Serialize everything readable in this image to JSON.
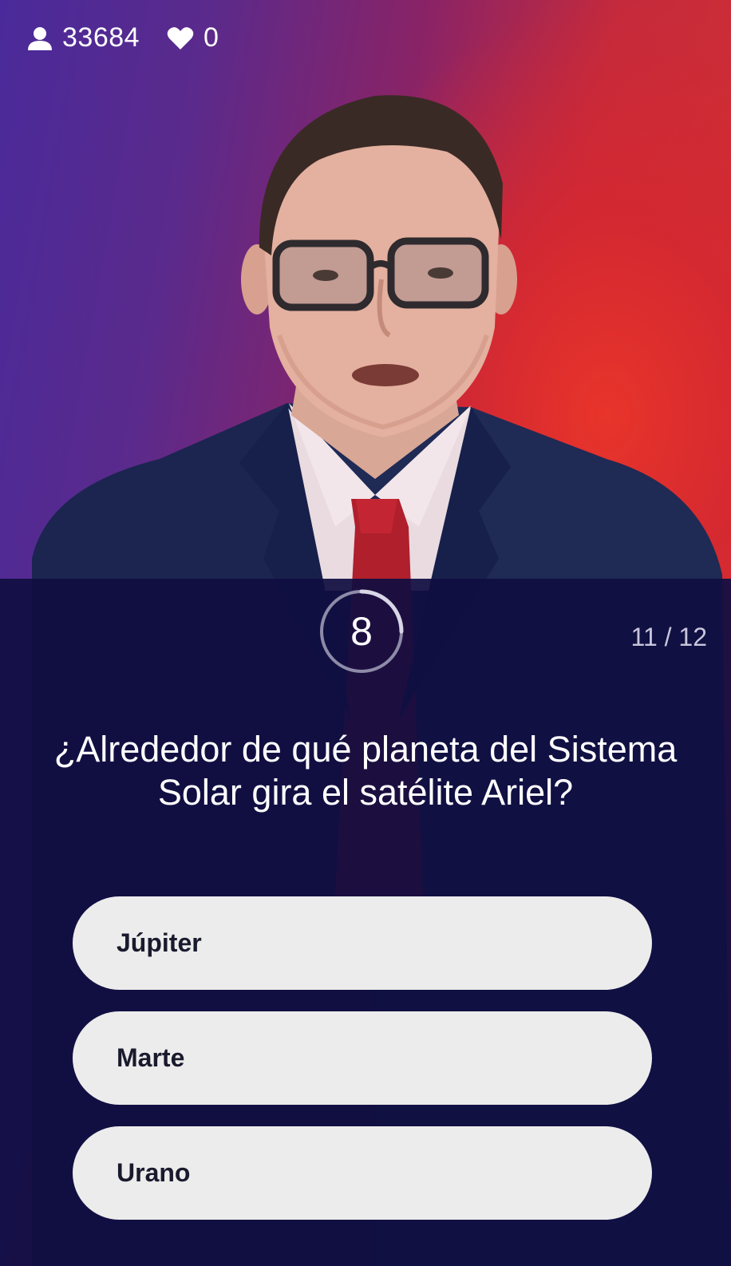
{
  "header": {
    "viewers_icon": "user-icon",
    "viewers_count": "33684",
    "lives_icon": "heart-icon",
    "lives_count": "0"
  },
  "quiz": {
    "timer_value": "8",
    "timer_progress": 0.25,
    "question_progress": "11 / 12",
    "question": "¿Alrededor de qué planeta del Sistema Solar gira el satélite Ariel?",
    "answers": [
      {
        "label": "Júpiter"
      },
      {
        "label": "Marte"
      },
      {
        "label": "Urano"
      }
    ]
  },
  "colors": {
    "panel": "#100e42",
    "answer_bg": "#ececec",
    "answer_text": "#1a1a2e",
    "accent_red": "#d8322e",
    "accent_purple": "#4a2a9a"
  }
}
